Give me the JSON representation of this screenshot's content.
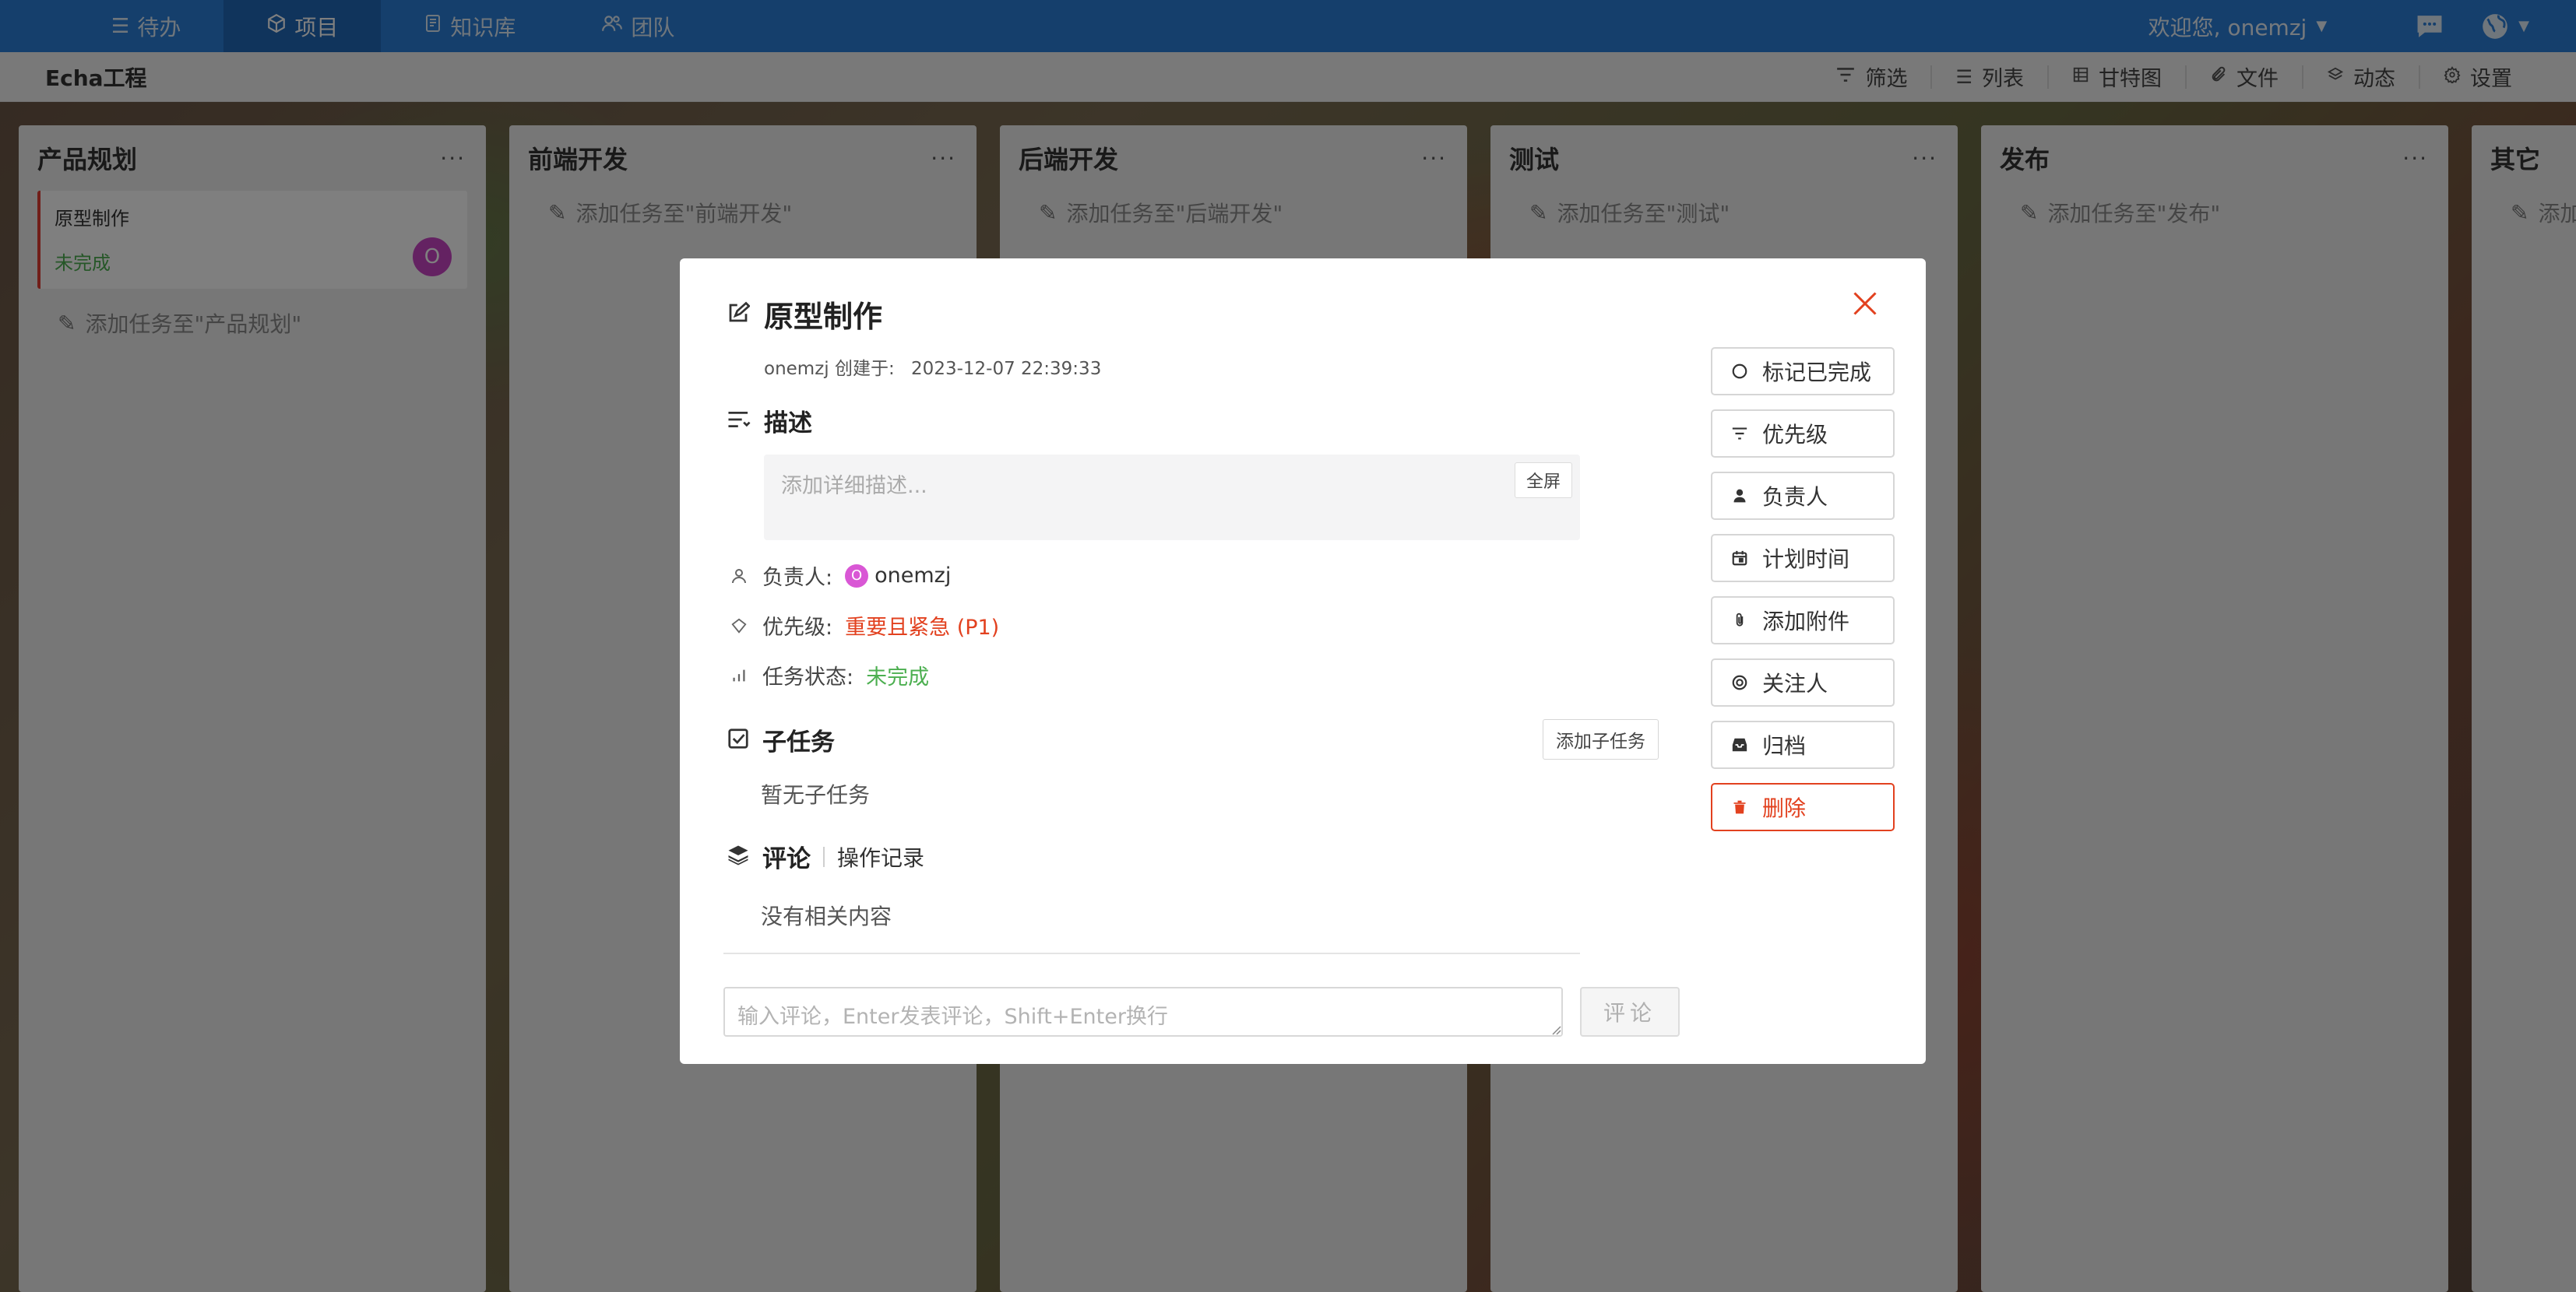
{
  "nav": {
    "items": [
      {
        "label": "待办",
        "icon": "list-icon"
      },
      {
        "label": "项目",
        "icon": "cube-icon"
      },
      {
        "label": "知识库",
        "icon": "document-icon"
      },
      {
        "label": "团队",
        "icon": "users-icon"
      }
    ],
    "welcome": "欢迎您, onemzj",
    "accent": "#2b7ed8"
  },
  "subheader": {
    "project_name": "Echa工程",
    "tools": [
      {
        "label": "筛选",
        "icon": "filter-icon"
      },
      {
        "label": "列表",
        "icon": "list-icon"
      },
      {
        "label": "甘特图",
        "icon": "gantt-icon"
      },
      {
        "label": "文件",
        "icon": "paperclip-icon"
      },
      {
        "label": "动态",
        "icon": "layers-icon"
      },
      {
        "label": "设置",
        "icon": "gear-icon"
      }
    ]
  },
  "columns": [
    {
      "title": "产品规划",
      "menu": "···",
      "add_label": "添加任务至\"产品规划\""
    },
    {
      "title": "前端开发",
      "menu": "···",
      "add_label": "添加任务至\"前端开发\""
    },
    {
      "title": "后端开发",
      "menu": "···",
      "add_label": "添加任务至\"后端开发\""
    },
    {
      "title": "测试",
      "menu": "···",
      "add_label": "添加任务至\"测试\""
    },
    {
      "title": "发布",
      "menu": "···",
      "add_label": "添加任务至\"发布\""
    },
    {
      "title": "其它",
      "menu": "···",
      "add_label": "添加"
    }
  ],
  "card": {
    "title": "原型制作",
    "status": "未完成",
    "avatar_initial": "O",
    "accent": "#e33d33"
  },
  "modal": {
    "title": "原型制作",
    "creator": "onemzj 创建于:",
    "created_at": "2023-12-07 22:39:33",
    "desc_label": "描述",
    "desc_placeholder": "添加详细描述...",
    "fullscreen_label": "全屏",
    "assignee_label": "负责人:",
    "assignee_initial": "O",
    "assignee_name": "onemzj",
    "priority_label": "优先级:",
    "priority_value": "重要且紧急 (P1)",
    "status_label": "任务状态:",
    "status_value": "未完成",
    "subtask_label": "子任务",
    "add_subtask_label": "添加子任务",
    "subtask_empty": "暂无子任务",
    "comment_tab": "评论",
    "log_tab": "操作记录",
    "comment_empty": "没有相关内容",
    "comment_placeholder": "输入评论，Enter发表评论，Shift+Enter换行",
    "comment_button": "评论",
    "actions": [
      {
        "label": "标记已完成",
        "icon": "circle-icon"
      },
      {
        "label": "优先级",
        "icon": "filter-icon"
      },
      {
        "label": "负责人",
        "icon": "user-icon"
      },
      {
        "label": "计划时间",
        "icon": "calendar-icon"
      },
      {
        "label": "添加附件",
        "icon": "paperclip-icon"
      },
      {
        "label": "关注人",
        "icon": "at-icon"
      },
      {
        "label": "归档",
        "icon": "inbox-icon"
      },
      {
        "label": "删除",
        "icon": "trash-icon"
      }
    ],
    "danger_color": "#e2411f",
    "success_color": "#4caf50"
  }
}
